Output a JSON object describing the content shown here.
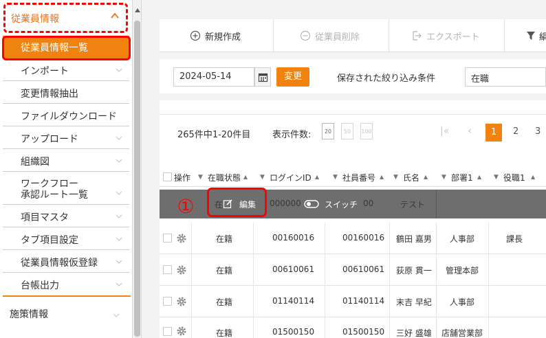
{
  "sidebar": {
    "header_label": "従業員情報",
    "active_item": "従業員情報一覧",
    "items": [
      {
        "label": "インポート"
      },
      {
        "label": "変更情報抽出"
      },
      {
        "label": "ファイルダウンロード"
      },
      {
        "label": "アップロード"
      },
      {
        "label": "組織図"
      },
      {
        "label": "ワークフロー",
        "label2": "承認ルート一覧"
      },
      {
        "label": "項目マスタ"
      },
      {
        "label": "タブ項目設定"
      },
      {
        "label": "従業員情報仮登録"
      },
      {
        "label": "台帳出力"
      }
    ],
    "section_label": "施策情報"
  },
  "toolbar": {
    "new_label": "新規作成",
    "delete_label": "従業員削除",
    "export_label": "エクスポート",
    "filter_label_partial": "絹"
  },
  "filter": {
    "date_value": "2024-05-14",
    "change_label": "変更",
    "saved_label": "保存された絞り込み条件",
    "saved_value": "在職"
  },
  "pager": {
    "count_text": "265件中1-20件目",
    "display_label": "表示件数:",
    "sizes": [
      "20",
      "50",
      "100"
    ],
    "first_glyph": "|«",
    "prev_glyph": "‹",
    "current_page": "1",
    "pages": [
      "2",
      "3"
    ]
  },
  "table": {
    "headers": {
      "op": "操作",
      "status": "在職状態",
      "login": "ログインID",
      "empno": "社員番号",
      "name": "氏名",
      "dept": "部署1",
      "role": "役職1"
    },
    "sort_glyph": "▼",
    "sort_up_glyph": "▲",
    "hover_row": {
      "status": "在",
      "login": "000000",
      "empno": "00",
      "name": "テスト",
      "edit_label": "編集",
      "switch_label": "スイッチ"
    },
    "rows": [
      {
        "status": "在籍",
        "login": "00160016",
        "empno": "00160016",
        "name": "鶴田 嘉男",
        "dept": "人事部",
        "role": "課長"
      },
      {
        "status": "在籍",
        "login": "00610061",
        "empno": "00610061",
        "name": "荻原 貫一",
        "dept": "管理本部",
        "role": ""
      },
      {
        "status": "在籍",
        "login": "01140114",
        "empno": "01140114",
        "name": "末吉 早紀",
        "dept": "人事部",
        "role": ""
      },
      {
        "status": "在籍",
        "login": "01500150",
        "empno": "01500150",
        "name": "三好 盛雄",
        "dept": "店舗営業部",
        "role": ""
      }
    ]
  },
  "annotation": {
    "number": "①"
  },
  "colors": {
    "accent": "#f0820f",
    "annotation": "#ff0000",
    "hover_row": "#6e6e6e"
  },
  "icons": {
    "new": "plus-circle-icon",
    "delete": "minus-circle-icon",
    "export": "export-icon",
    "filter": "funnel-icon",
    "calendar": "calendar-icon",
    "gear": "gear-icon",
    "edit": "edit-icon",
    "switch": "toggle-icon"
  }
}
